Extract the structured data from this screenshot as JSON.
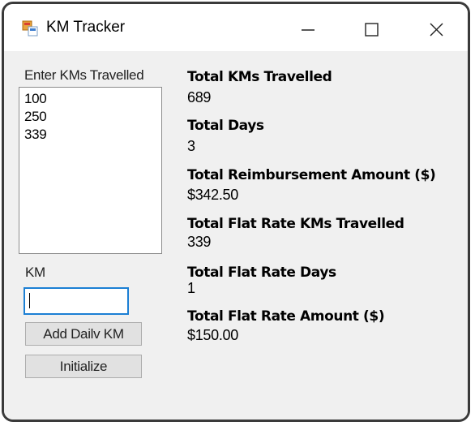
{
  "window": {
    "title": "KM Tracker",
    "icon": "app-icon"
  },
  "input_section": {
    "list_label": "Enter KMs Travelled",
    "list_items": [
      "100",
      "250",
      "339"
    ],
    "km_label": "KM",
    "km_value": "",
    "add_button": "Add Dailv KM",
    "initialize_button": "Initialize"
  },
  "stats": [
    {
      "title": "Total KMs Travelled",
      "value": "689"
    },
    {
      "title": "Total Days",
      "value": "3"
    },
    {
      "title": "Total Reimbursement Amount ($)",
      "value": "$342.50"
    },
    {
      "title": "Total Flat Rate KMs Travelled",
      "value": "339"
    },
    {
      "title": "Total Flat Rate Days",
      "value": "1"
    },
    {
      "title": "Total Flat Rate Amount ($)",
      "value": "$150.00"
    }
  ],
  "colors": {
    "focus_border": "#1b7fd4",
    "button_face": "#e1e1e1",
    "client_background": "#f0f0f0"
  }
}
